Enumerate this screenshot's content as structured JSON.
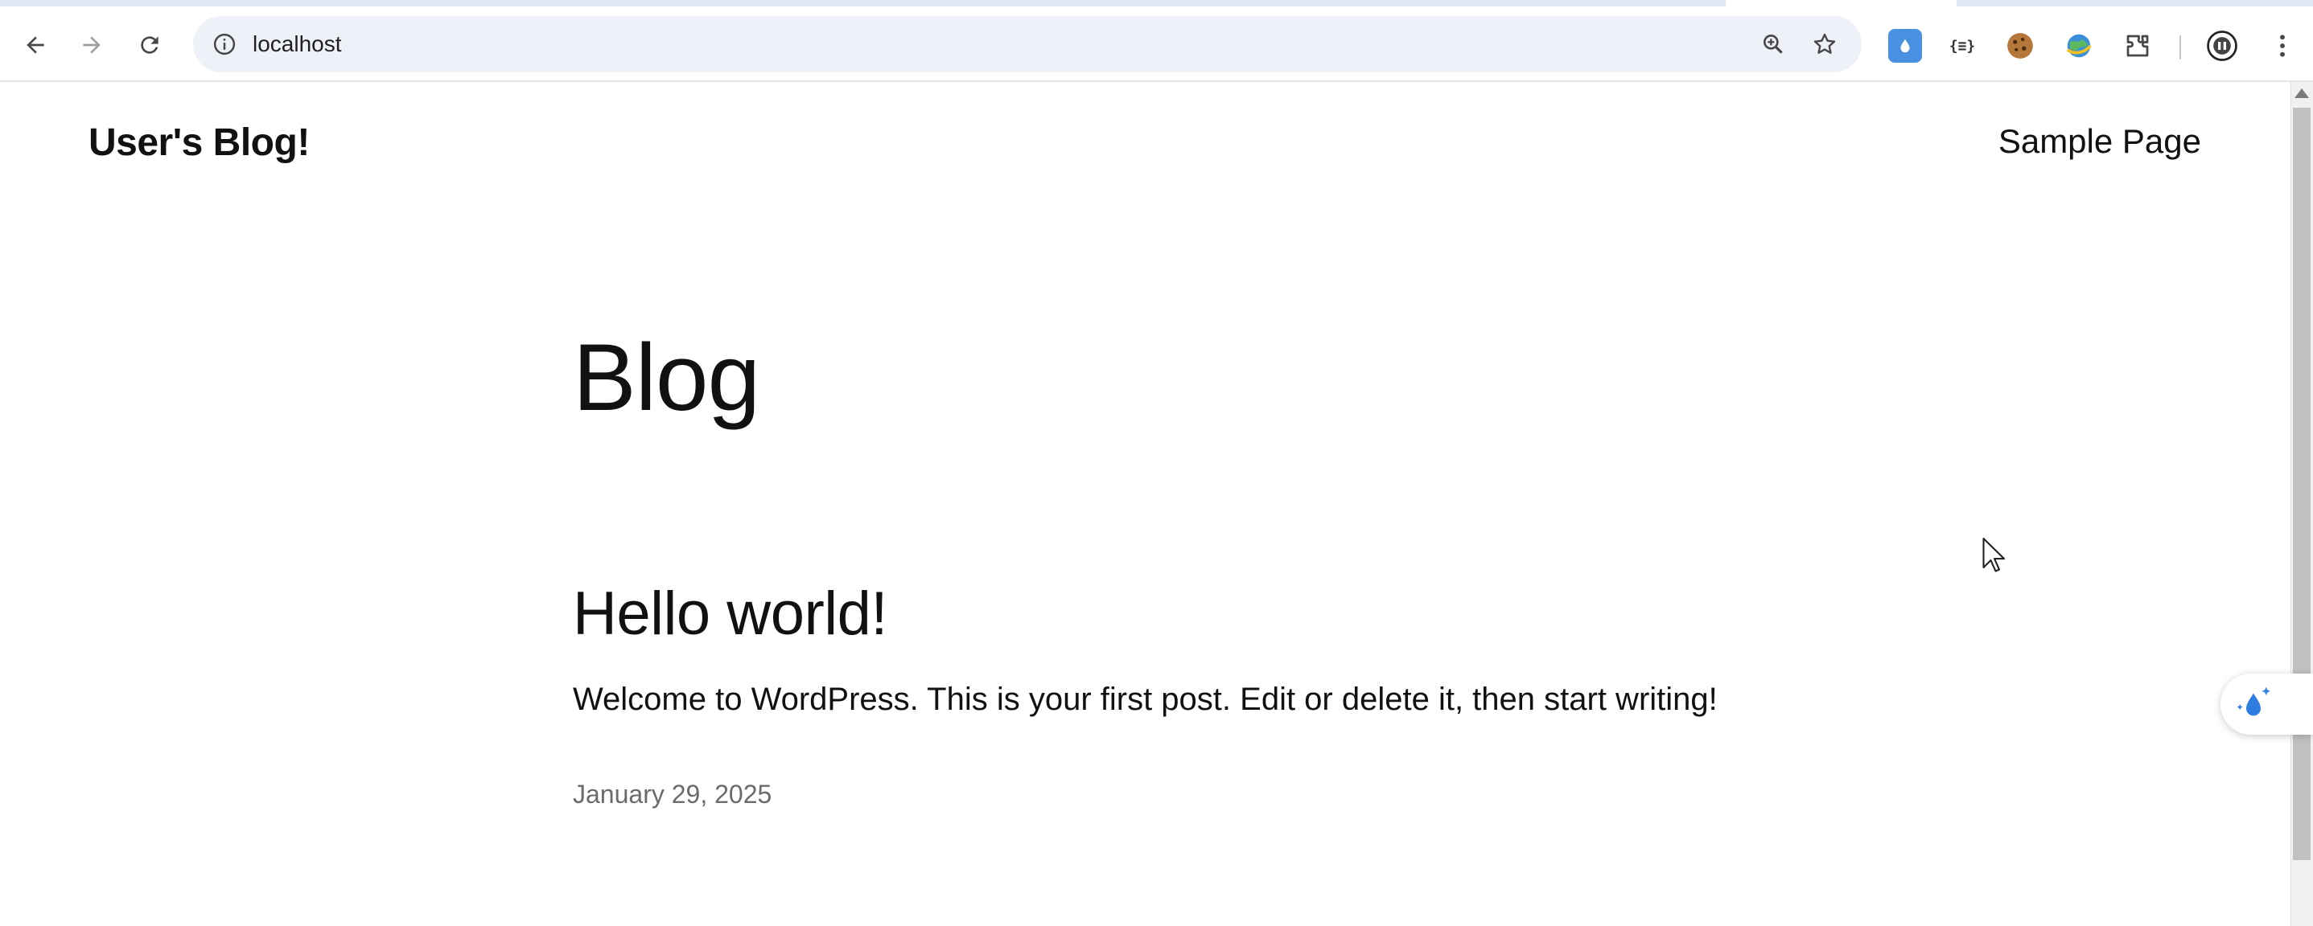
{
  "browser": {
    "url": "localhost",
    "icons": {
      "back": "back-arrow-icon",
      "forward": "forward-arrow-icon",
      "reload": "reload-icon",
      "site_info": "info-icon",
      "zoom": "zoom-icon",
      "bookmark": "star-icon",
      "extensions": [
        "water-drop-extension-icon",
        "json-extension-icon",
        "cookie-extension-icon",
        "globe-extension-icon",
        "puzzle-extensions-icon"
      ],
      "profile": "profile-avatar-icon",
      "menu": "kebab-menu-icon"
    },
    "json_ext_label": "{≡}"
  },
  "site": {
    "title": "User's Blog!",
    "nav": [
      "Sample Page"
    ]
  },
  "main": {
    "heading": "Blog",
    "posts": [
      {
        "title": "Hello world!",
        "excerpt": "Welcome to WordPress. This is your first post. Edit or delete it, then start writing!",
        "date": "January 29, 2025"
      }
    ]
  },
  "widget": {
    "icon": "sparkle-drop-icon",
    "color": "#2f7de1"
  },
  "colors": {
    "text": "#111111",
    "muted": "#6b6b6b",
    "omnibox": "#eef1f8",
    "accent_blue": "#4a90e2"
  }
}
